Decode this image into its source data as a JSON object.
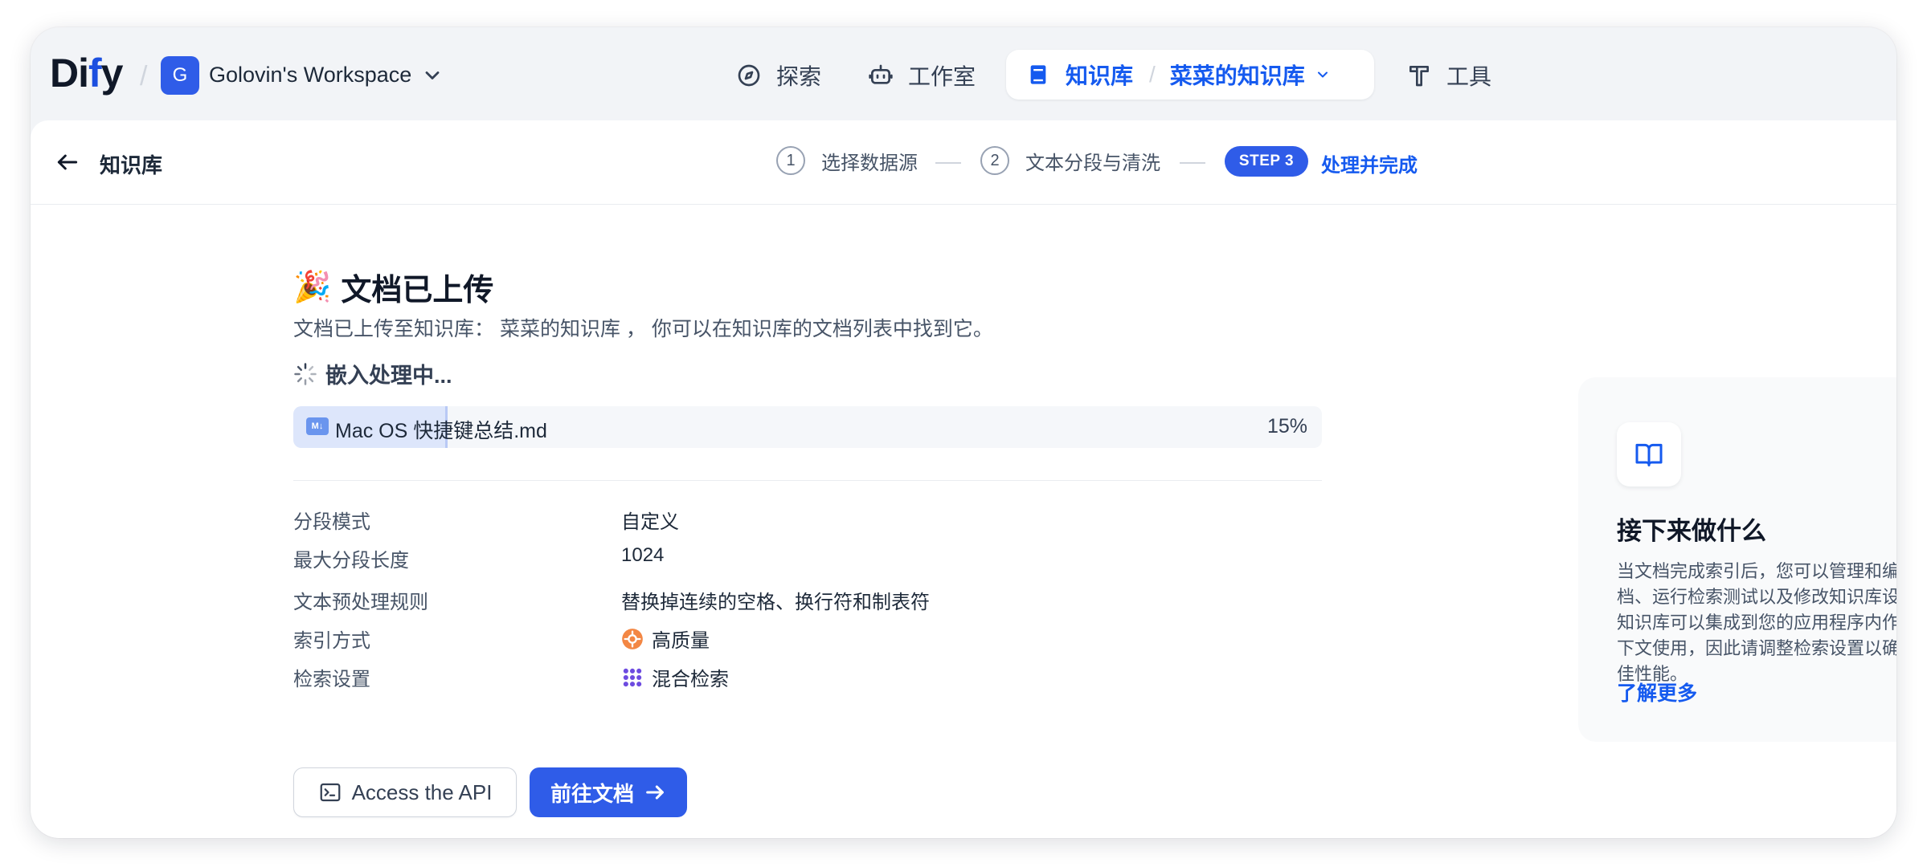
{
  "header": {
    "logo_main": "Di",
    "logo_accent": "f",
    "logo_tail": "y",
    "workspace_initial": "G",
    "workspace_name": "Golovin's Workspace",
    "nav": {
      "explore": "探索",
      "studio": "工作室",
      "knowledge": "知识库",
      "current_dataset": "菜菜的知识库",
      "tools": "工具"
    }
  },
  "subheader": {
    "back_label": "知识库",
    "steps": [
      {
        "number": "1",
        "label": "选择数据源"
      },
      {
        "number": "2",
        "label": "文本分段与清洗"
      },
      {
        "number": "STEP 3",
        "label": "处理并完成"
      }
    ]
  },
  "main": {
    "title_emoji": "🎉",
    "title": "文档已上传",
    "subtitle": "文档已上传至知识库： 菜菜的知识库 ， 你可以在知识库的文档列表中找到它。",
    "embed_status": "嵌入处理中...",
    "file": {
      "icon_text": "M↓",
      "name": "Mac OS 快捷键总结.md",
      "percent_text": "15%",
      "progress": 0.15
    },
    "info": [
      {
        "label": "分段模式",
        "value": "自定义",
        "icon": ""
      },
      {
        "label": "最大分段长度",
        "value": "1024",
        "icon": ""
      },
      {
        "label": "文本预处理规则",
        "value": "替换掉连续的空格、换行符和制表符",
        "icon": ""
      },
      {
        "label": "索引方式",
        "value": "高质量",
        "icon": "high-quality-icon"
      },
      {
        "label": "检索设置",
        "value": "混合检索",
        "icon": "hybrid-search-icon"
      }
    ],
    "buttons": {
      "api": "Access the API",
      "docs": "前往文档"
    }
  },
  "side_card": {
    "title": "接下来做什么",
    "desc": "当文档完成索引后，您可以管理和编辑文档、运行检索测试以及修改知识库设置。知识库可以集成到您的应用程序内作为上下文使用，因此请调整检索设置以确保最佳性能。",
    "link": "了解更多"
  },
  "colors": {
    "accent": "#155aef",
    "primary_button": "#2f5ce8",
    "progress_fill": "#dde6fb"
  }
}
